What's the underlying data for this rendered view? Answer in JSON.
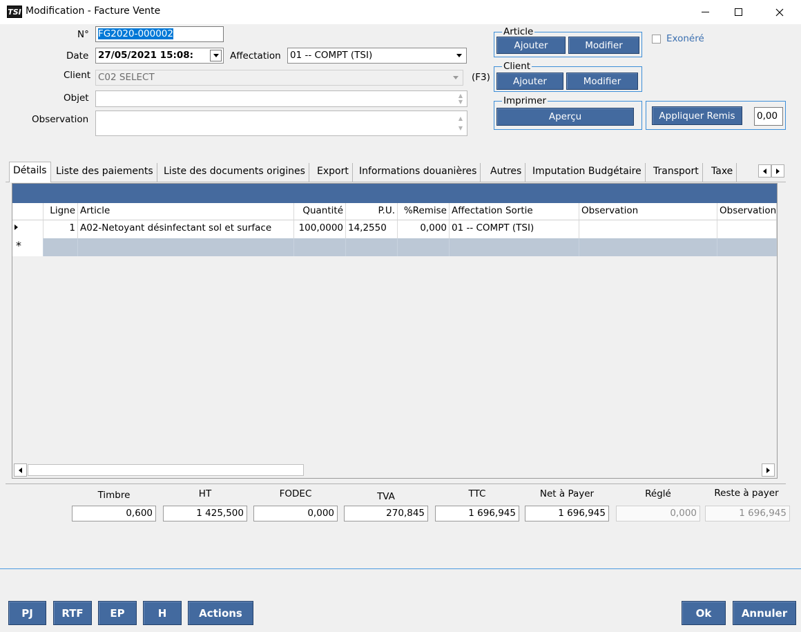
{
  "window": {
    "title": "Modification - Facture Vente",
    "logo_text": "TSI"
  },
  "form": {
    "numero_label": "N°",
    "numero_value": "FG2020-000002",
    "date_label": "Date",
    "date_value": "27/05/2021 15:08:",
    "affectation_label": "Affectation",
    "affectation_value": "01 -- COMPT (TSI)",
    "client_label": "Client",
    "client_value": "C02 SELECT",
    "client_hint": "(F3)",
    "objet_label": "Objet",
    "objet_value": "",
    "observation_label": "Observation",
    "observation_value": ""
  },
  "groups": {
    "article": {
      "title": "Article",
      "add": "Ajouter",
      "edit": "Modifier"
    },
    "client": {
      "title": "Client",
      "add": "Ajouter",
      "edit": "Modifier"
    },
    "imprimer": {
      "title": "Imprimer",
      "preview": "Aperçu"
    },
    "exonere_label": "Exonéré",
    "exonere_checked": false,
    "remise_button": "Appliquer Remis",
    "remise_value": "0,00"
  },
  "tabs": [
    "Détails",
    "Liste des paiements",
    "Liste des documents origines",
    "Export",
    "Informations douanières",
    "Autres",
    "Imputation Budgétaire",
    "Transport",
    "Taxe"
  ],
  "grid": {
    "headers": [
      "Ligne",
      "Article",
      "Quantité",
      "P.U.",
      "%Remise",
      "Affectation Sortie",
      "Observation",
      "Observation"
    ],
    "rows": [
      {
        "ligne": "1",
        "article": "A02-Netoyant désinfectant sol et surface",
        "quantite": "100,0000",
        "pu": "14,2550",
        "remise": "0,000",
        "affectation": "01 -- COMPT (TSI)",
        "observation": "",
        "observation2": ""
      }
    ],
    "new_row_marker": "*"
  },
  "totals": {
    "labels": [
      "Timbre",
      "HT",
      "FODEC",
      "TVA",
      "TTC",
      "Net à Payer",
      "Réglé",
      "Reste à payer"
    ],
    "values": [
      "0,600",
      "1 425,500",
      "0,000",
      "270,845",
      "1 696,945",
      "1 696,945",
      "0,000",
      "1 696,945"
    ]
  },
  "footer": {
    "left_buttons": [
      "PJ",
      "RTF",
      "EP",
      "H",
      "Actions"
    ],
    "ok": "Ok",
    "cancel": "Annuler"
  },
  "colors": {
    "accent": "#436a9f",
    "grid_bar": "#456a9e",
    "new_row": "#bcc8d6",
    "groupbox_border": "#3c8ed8",
    "selection": "#0078d7"
  }
}
